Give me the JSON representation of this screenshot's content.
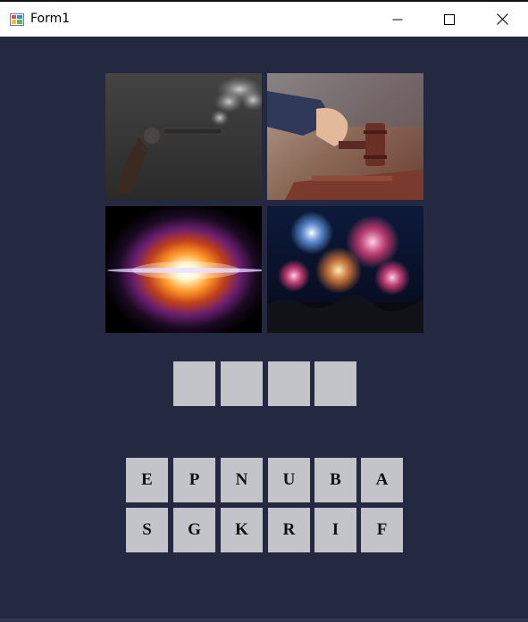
{
  "window": {
    "title": "Form1",
    "controls": [
      "minimize-icon",
      "maximize-icon",
      "close-icon"
    ]
  },
  "pictures": [
    {
      "name": "revolver-picture"
    },
    {
      "name": "gavel-picture"
    },
    {
      "name": "explosion-picture"
    },
    {
      "name": "fireworks-picture"
    }
  ],
  "answer": {
    "slots": [
      "",
      "",
      "",
      ""
    ]
  },
  "letters": {
    "row1": [
      "E",
      "P",
      "N",
      "U",
      "B",
      "A"
    ],
    "row2": [
      "S",
      "G",
      "K",
      "R",
      "I",
      "F"
    ]
  },
  "colors": {
    "background": "#242840",
    "tile": "#c3c4c9",
    "titlebar": "#ffffff"
  }
}
